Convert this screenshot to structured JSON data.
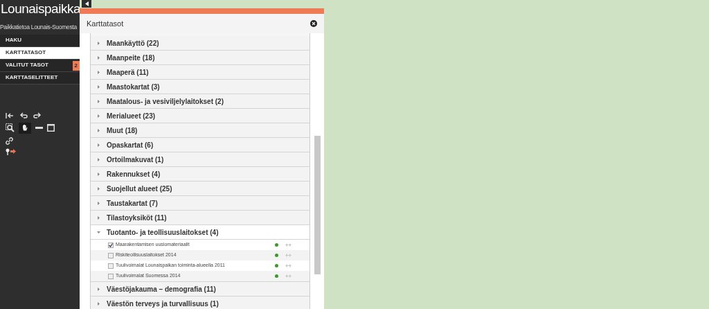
{
  "sidebar": {
    "logo": "Lounaispaikka",
    "subtitle": "Paikkatietoa Lounais-Suomesta",
    "items": [
      {
        "label": "HAKU",
        "selected": false
      },
      {
        "label": "KARTTATASOT",
        "selected": true
      },
      {
        "label": "VALITUT TASOT",
        "selected": false,
        "badge": "2"
      },
      {
        "label": "KARTTASELITTEET",
        "selected": false
      }
    ]
  },
  "panel": {
    "title": "Karttatasot",
    "categories": [
      {
        "label": "Maankäyttö (22)",
        "expanded": false
      },
      {
        "label": "Maanpeite (18)",
        "expanded": false
      },
      {
        "label": "Maaperä (11)",
        "expanded": false
      },
      {
        "label": "Maastokartat (3)",
        "expanded": false
      },
      {
        "label": "Maatalous- ja vesiviljelylaitokset (2)",
        "expanded": false
      },
      {
        "label": "Merialueet (23)",
        "expanded": false
      },
      {
        "label": "Muut (18)",
        "expanded": false
      },
      {
        "label": "Opaskartat (6)",
        "expanded": false
      },
      {
        "label": "Ortoilmakuvat (1)",
        "expanded": false
      },
      {
        "label": "Rakennukset (4)",
        "expanded": false
      },
      {
        "label": "Suojellut alueet (25)",
        "expanded": false
      },
      {
        "label": "Taustakartat (7)",
        "expanded": false
      },
      {
        "label": "Tilastoyksiköt (11)",
        "expanded": false
      },
      {
        "label": "Tuotanto- ja teollisuuslaitokset (4)",
        "expanded": true,
        "children": [
          {
            "label": "Maarakentamisen uusiomateriaalit",
            "checked": true
          },
          {
            "label": "Riskiteollisuuslaitokset 2014",
            "checked": false
          },
          {
            "label": "Tuulivoimalat Lounaispaikan toiminta-alueella 2011",
            "checked": false
          },
          {
            "label": "Tuulivoimalat Suomessa 2014",
            "checked": false
          }
        ]
      },
      {
        "label": "Väestöjakauma – demografia (11)",
        "expanded": false
      },
      {
        "label": "Väestön terveys ja turvallisuus (1)",
        "expanded": false
      }
    ]
  }
}
